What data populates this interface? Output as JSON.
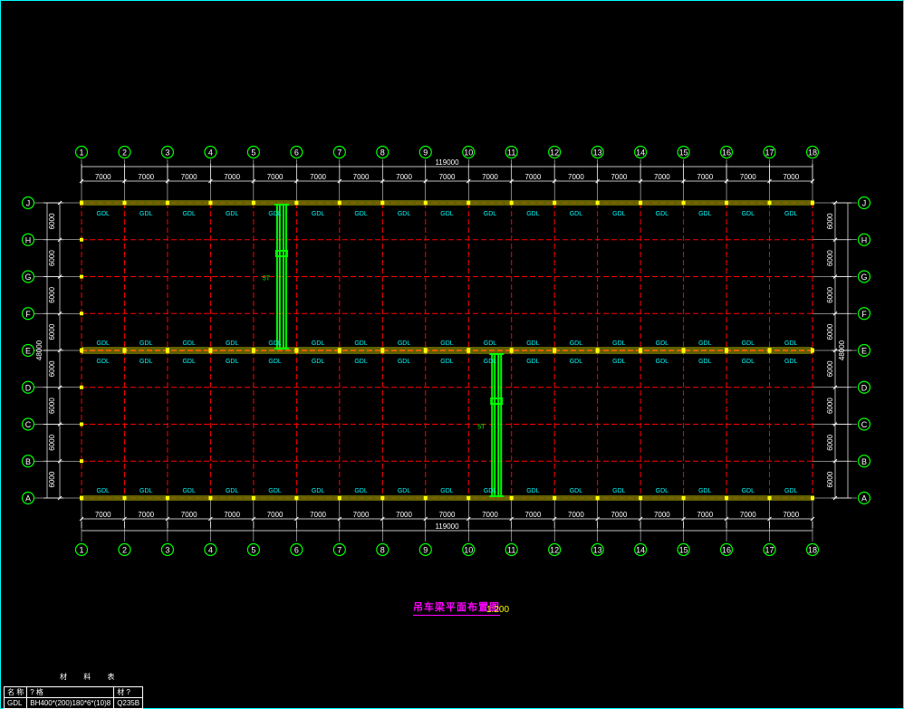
{
  "drawing": {
    "title": "吊车梁平面布置图",
    "scale": "1:200",
    "column_axes": [
      "1",
      "2",
      "3",
      "4",
      "5",
      "6",
      "7",
      "8",
      "9",
      "10",
      "11",
      "12",
      "13",
      "14",
      "15",
      "16",
      "17",
      "18"
    ],
    "row_axes": [
      "J",
      "H",
      "G",
      "F",
      "E",
      "D",
      "C",
      "B",
      "A"
    ],
    "bay_dim": "7000",
    "total_width_dim": "119000",
    "row_dim": "6000",
    "total_depth_dim": "48000",
    "beam_label": "GDL",
    "crane_label": "5T"
  },
  "material_table": {
    "caption": "材 料 表",
    "headers": [
      "名 称",
      "? 格",
      "材 ?"
    ],
    "rows": [
      [
        "GDL",
        "BH400*(200)180*6*(10)8",
        "Q235B"
      ]
    ]
  },
  "colors": {
    "frame": "#00ffff",
    "axis_bubble": "#00ff00",
    "dimension": "#ffffff",
    "grid": "#ff0000",
    "crane_beam": "#ffff00",
    "crane": "#00ff00",
    "beam_label": "#00ffff",
    "title": "#ff00ff"
  }
}
